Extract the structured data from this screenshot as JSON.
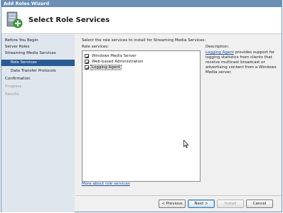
{
  "window": {
    "title": "Add Roles Wizard"
  },
  "banner": {
    "title": "Select Role Services",
    "icon": "server-roles-add-icon"
  },
  "nav": {
    "items": [
      {
        "label": "Before You Begin",
        "state": "normal",
        "level": 0
      },
      {
        "label": "Server Roles",
        "state": "normal",
        "level": 0
      },
      {
        "label": "Streaming Media Services",
        "state": "normal",
        "level": 0
      },
      {
        "label": "Role Services",
        "state": "active",
        "level": 1
      },
      {
        "label": "Data Transfer Protocols",
        "state": "normal",
        "level": 1
      },
      {
        "label": "Confirmation",
        "state": "normal",
        "level": 0
      },
      {
        "label": "Progress",
        "state": "disabled",
        "level": 0
      },
      {
        "label": "Results",
        "state": "disabled",
        "level": 0
      }
    ]
  },
  "main": {
    "instruction": "Select the role services to install for Streaming Media Services:",
    "list_label": "Role services:",
    "role_services": [
      {
        "label": "Windows Media Server",
        "checked": true,
        "selected": false
      },
      {
        "label": "Web-based Administration",
        "checked": true,
        "selected": false
      },
      {
        "label": "Logging Agent",
        "checked": true,
        "selected": true
      }
    ],
    "description_label": "Description:",
    "description_link": "Logging Agent",
    "description_text": " provides support for logging statistics from clients that receive multicast broadcast or advertising content from a Windows Media server.",
    "more_link": "More about role services"
  },
  "buttons": {
    "previous": "< Previous",
    "next": "Next >",
    "install": "Install",
    "cancel": "Cancel"
  },
  "colors": {
    "nav_active": "#2a5b94",
    "nav_bg": "#dfe6ee",
    "link": "#1a4fa0",
    "titlebar": "#6a8fb5"
  }
}
